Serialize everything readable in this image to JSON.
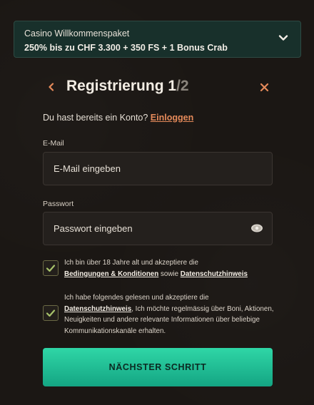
{
  "promo": {
    "title": "Casino Willkommenspaket",
    "offer": "250% bis zu CHF 3.300 + 350 FS + 1 Bonus Crab"
  },
  "header": {
    "title": "Registrierung",
    "step_current": "1",
    "step_total": "/2"
  },
  "login": {
    "prompt": "Du hast bereits ein Konto? ",
    "link": "Einloggen"
  },
  "email": {
    "label": "E-Mail",
    "placeholder": "E-Mail eingeben"
  },
  "password": {
    "label": "Passwort",
    "placeholder": "Passwort eingeben"
  },
  "consent1": {
    "text_a": "Ich bin über 18 Jahre alt und akzeptiere die",
    "terms_link": "Bedingungen & Konditionen",
    "text_b": " sowie ",
    "privacy_link": "Datenschutzhinweis"
  },
  "consent2": {
    "text_a": "Ich habe folgendes gelesen und akzeptiere die ",
    "privacy_link": "Datenschutzhinweis",
    "text_b": ", Ich möchte regelmässig über Boni, Aktionen, Neuigkeiten und andere relevante Informationen über beliebige Kommunikationskanäle erhalten."
  },
  "submit": {
    "label": "NÄCHSTER SCHRITT"
  },
  "colors": {
    "accent_orange": "#e58a5a",
    "button_green": "#1fc196",
    "background": "#1b1714",
    "promo_bg": "#18302b",
    "check_green": "#a7c26a"
  }
}
